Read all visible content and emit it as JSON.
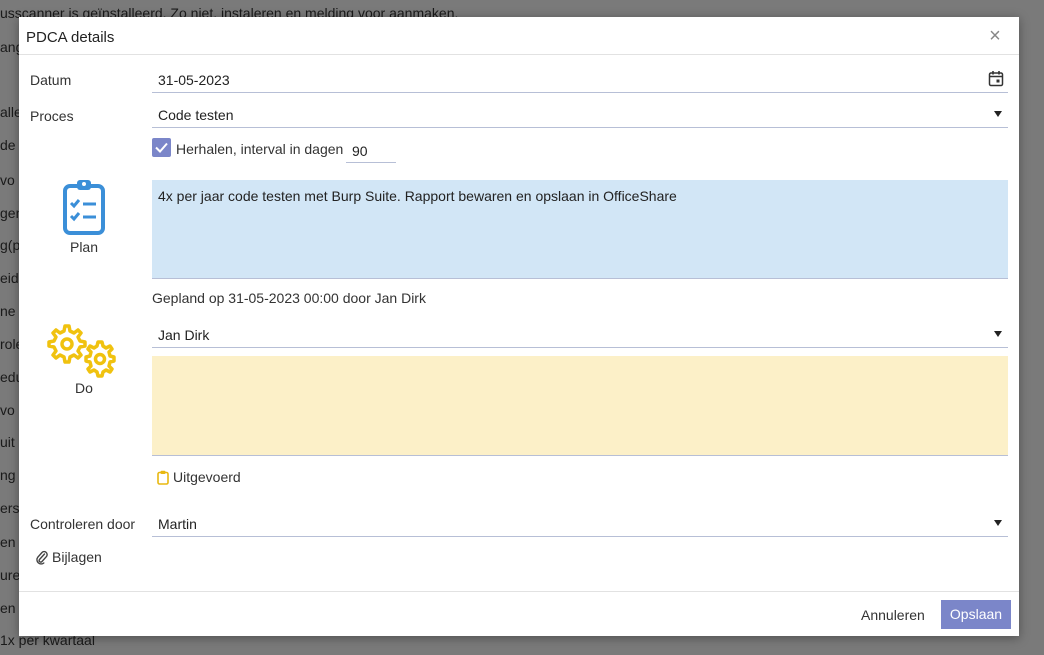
{
  "background": {
    "lines": [
      "usscanner is geïnstalleerd. Zo niet, instaleren en melding voor aanmaken.",
      "ang",
      "alle",
      "de",
      "vo",
      "gen",
      "g(p",
      "eid",
      "ne",
      "role",
      "edu",
      "vo",
      "uit",
      "ng",
      "ers v",
      "en",
      "ure",
      "en r",
      "1x per kwartaal"
    ]
  },
  "dialog": {
    "title": "PDCA details",
    "close_glyph": "×",
    "datum": {
      "label": "Datum",
      "value": "31-05-2023"
    },
    "proces": {
      "label": "Proces",
      "value": "Code testen"
    },
    "repeat": {
      "label": "Herhalen, interval in dagen",
      "checked": true,
      "interval": "90"
    },
    "plan": {
      "label": "Plan",
      "text": "4x per jaar code testen met Burp Suite. Rapport bewaren en opslaan in OfficeShare",
      "planned_info": "Gepland op 31-05-2023 00:00 door Jan Dirk",
      "icon_color": "#3b8fd8",
      "area_color": "#d2e6f6"
    },
    "do": {
      "label": "Do",
      "assignee": "Jan Dirk",
      "text": "",
      "done_label": "Uitgevoerd",
      "icon_color": "#f0c20f",
      "area_color": "#fcf0c8"
    },
    "check": {
      "label": "Controleren door",
      "value": "Martin"
    },
    "attachments_label": "Bijlagen",
    "cancel_label": "Annuleren",
    "save_label": "Opslaan",
    "accent_color": "#7b86c9"
  }
}
